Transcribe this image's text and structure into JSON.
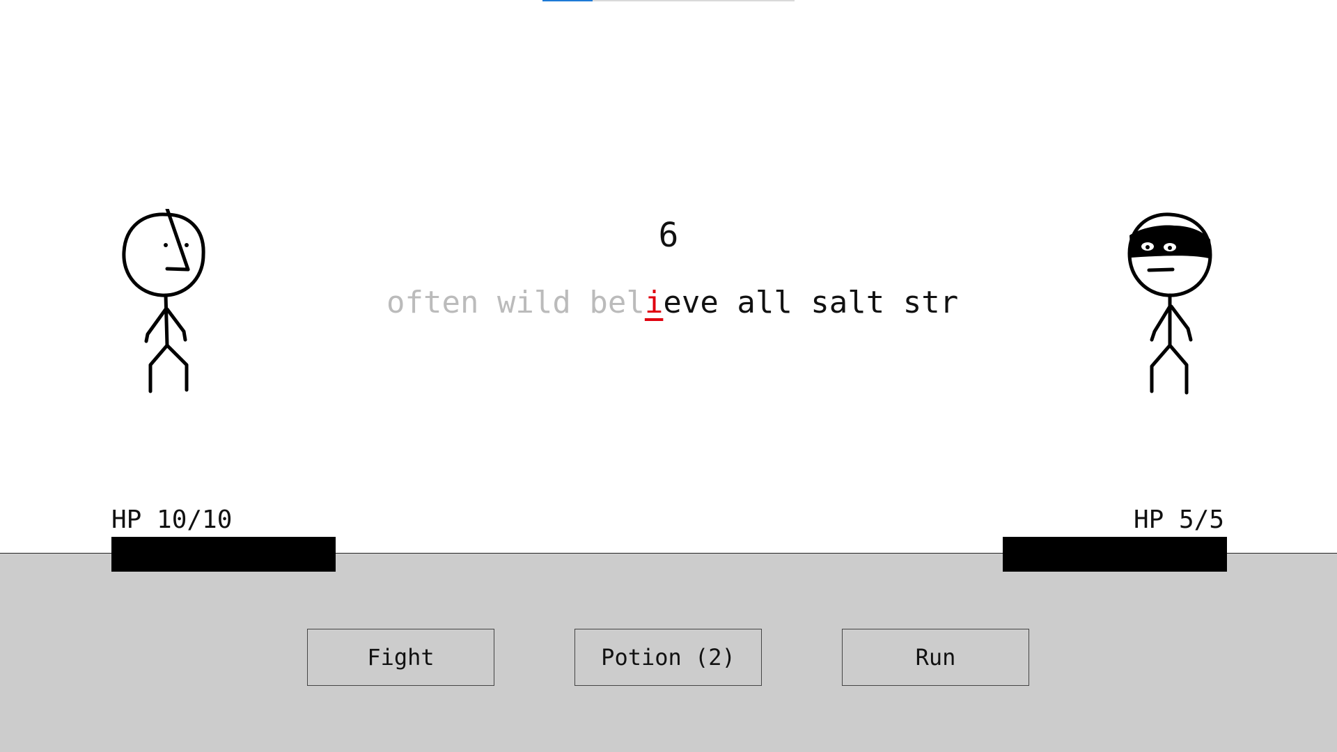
{
  "progress": {
    "fraction": 0.2
  },
  "countdown": "6",
  "typing": {
    "typed": "often wild bel",
    "current": "i",
    "pending": "eve all salt str"
  },
  "player": {
    "hp_label": "HP 10/10",
    "hp_current": 10,
    "hp_max": 10
  },
  "enemy": {
    "hp_label": "HP 5/5",
    "hp_current": 5,
    "hp_max": 5
  },
  "actions": {
    "fight_label": "Fight",
    "potion_label": "Potion (2)",
    "run_label": "Run"
  },
  "colors": {
    "ground": "#cccccc",
    "progress": "#1e7ad6",
    "current_char": "#e0000f",
    "typed_text": "#bbbbbb",
    "hp_bar": "#000000"
  }
}
